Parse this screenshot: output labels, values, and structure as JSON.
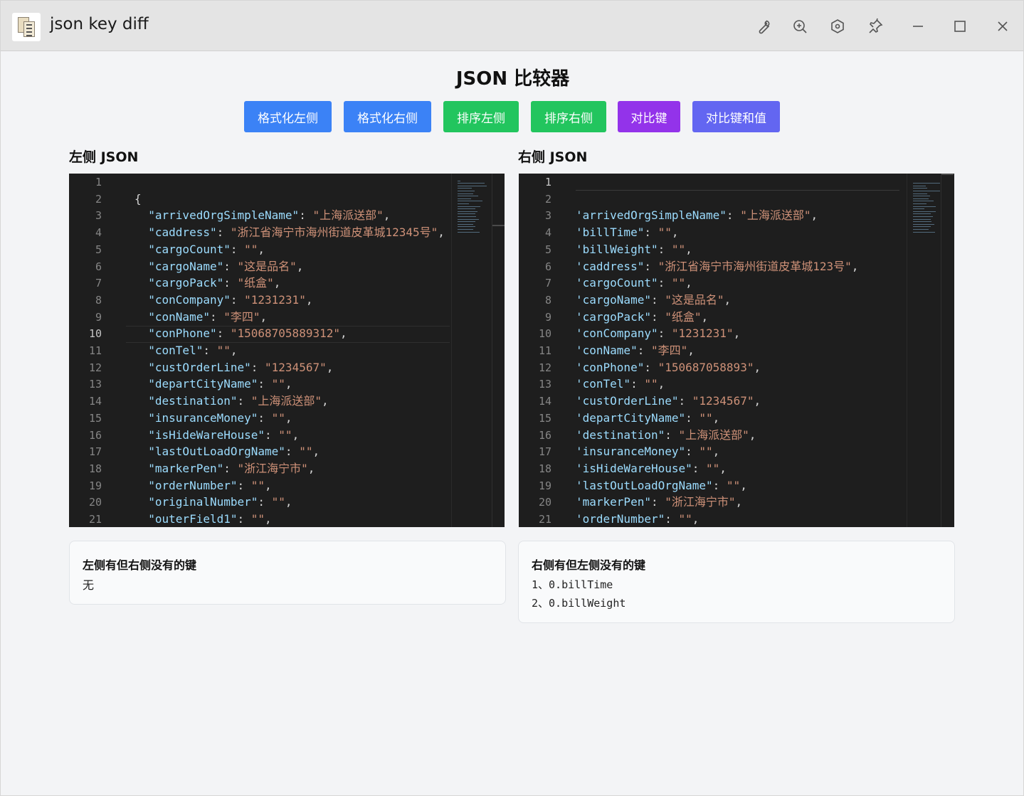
{
  "window": {
    "title": "json key diff",
    "icons": [
      "wrench-icon",
      "zoom-in-icon",
      "hexagon-settings-icon",
      "pin-icon",
      "minimize-icon",
      "maximize-icon",
      "close-icon"
    ]
  },
  "page": {
    "title": "JSON 比较器",
    "buttons": {
      "format_left": "格式化左侧",
      "format_right": "格式化右侧",
      "sort_left": "排序左侧",
      "sort_right": "排序右侧",
      "compare_keys": "对比键",
      "compare_keys_values": "对比键和值"
    },
    "colors": {
      "blue": "#3b82f6",
      "green": "#22c55e",
      "purple": "#9333ea",
      "indigo": "#6366f1",
      "editor_bg": "#1e1e1e",
      "key": "#9cdcfe",
      "string": "#ce9178"
    }
  },
  "left": {
    "label": "左侧 JSON",
    "active_line": 10,
    "lines": [
      {
        "n": "1",
        "indent": "",
        "key": "",
        "val": "",
        "raw": ""
      },
      {
        "n": "2",
        "indent": "",
        "key": "",
        "val": "",
        "raw": "{"
      },
      {
        "n": "3",
        "indent": "  ",
        "key": "\"arrivedOrgSimpleName\"",
        "val": "\"上海派送部\"",
        "raw": ""
      },
      {
        "n": "4",
        "indent": "  ",
        "key": "\"caddress\"",
        "val": "\"浙江省海宁市海州街道皮革城12345号\"",
        "raw": ""
      },
      {
        "n": "5",
        "indent": "  ",
        "key": "\"cargoCount\"",
        "val": "\"\"",
        "raw": ""
      },
      {
        "n": "6",
        "indent": "  ",
        "key": "\"cargoName\"",
        "val": "\"这是品名\"",
        "raw": ""
      },
      {
        "n": "7",
        "indent": "  ",
        "key": "\"cargoPack\"",
        "val": "\"纸盒\"",
        "raw": ""
      },
      {
        "n": "8",
        "indent": "  ",
        "key": "\"conCompany\"",
        "val": "\"1231231\"",
        "raw": ""
      },
      {
        "n": "9",
        "indent": "  ",
        "key": "\"conName\"",
        "val": "\"李四\"",
        "raw": ""
      },
      {
        "n": "10",
        "indent": "  ",
        "key": "\"conPhone\"",
        "val": "\"15068705889312\"",
        "raw": ""
      },
      {
        "n": "11",
        "indent": "  ",
        "key": "\"conTel\"",
        "val": "\"\"",
        "raw": ""
      },
      {
        "n": "12",
        "indent": "  ",
        "key": "\"custOrderLine\"",
        "val": "\"1234567\"",
        "raw": ""
      },
      {
        "n": "13",
        "indent": "  ",
        "key": "\"departCityName\"",
        "val": "\"\"",
        "raw": ""
      },
      {
        "n": "14",
        "indent": "  ",
        "key": "\"destination\"",
        "val": "\"上海派送部\"",
        "raw": ""
      },
      {
        "n": "15",
        "indent": "  ",
        "key": "\"insuranceMoney\"",
        "val": "\"\"",
        "raw": ""
      },
      {
        "n": "16",
        "indent": "  ",
        "key": "\"isHideWareHouse\"",
        "val": "\"\"",
        "raw": ""
      },
      {
        "n": "17",
        "indent": "  ",
        "key": "\"lastOutLoadOrgName\"",
        "val": "\"\"",
        "raw": ""
      },
      {
        "n": "18",
        "indent": "  ",
        "key": "\"markerPen\"",
        "val": "\"浙江海宁市\"",
        "raw": ""
      },
      {
        "n": "19",
        "indent": "  ",
        "key": "\"orderNumber\"",
        "val": "\"\"",
        "raw": ""
      },
      {
        "n": "20",
        "indent": "  ",
        "key": "\"originalNumber\"",
        "val": "\"\"",
        "raw": ""
      },
      {
        "n": "21",
        "indent": "  ",
        "key": "\"outerField1\"",
        "val": "\"\"",
        "raw": ""
      }
    ]
  },
  "right": {
    "label": "右侧 JSON",
    "active_line": 1,
    "lines": [
      {
        "n": "1",
        "key": "",
        "val": ""
      },
      {
        "n": "2",
        "key": "",
        "val": ""
      },
      {
        "n": "3",
        "key": "'arrivedOrgSimpleName\"",
        "val": "\"上海派送部\""
      },
      {
        "n": "4",
        "key": "'billTime\"",
        "val": "\"\""
      },
      {
        "n": "5",
        "key": "'billWeight\"",
        "val": "\"\""
      },
      {
        "n": "6",
        "key": "'caddress\"",
        "val": "\"浙江省海宁市海州街道皮革城123号\""
      },
      {
        "n": "7",
        "key": "'cargoCount\"",
        "val": "\"\""
      },
      {
        "n": "8",
        "key": "'cargoName\"",
        "val": "\"这是品名\""
      },
      {
        "n": "9",
        "key": "'cargoPack\"",
        "val": "\"纸盒\""
      },
      {
        "n": "10",
        "key": "'conCompany\"",
        "val": "\"1231231\""
      },
      {
        "n": "11",
        "key": "'conName\"",
        "val": "\"李四\""
      },
      {
        "n": "12",
        "key": "'conPhone\"",
        "val": "\"150687058893\""
      },
      {
        "n": "13",
        "key": "'conTel\"",
        "val": "\"\""
      },
      {
        "n": "14",
        "key": "'custOrderLine\"",
        "val": "\"1234567\""
      },
      {
        "n": "15",
        "key": "'departCityName\"",
        "val": "\"\""
      },
      {
        "n": "16",
        "key": "'destination\"",
        "val": "\"上海派送部\""
      },
      {
        "n": "17",
        "key": "'insuranceMoney\"",
        "val": "\"\""
      },
      {
        "n": "18",
        "key": "'isHideWareHouse\"",
        "val": "\"\""
      },
      {
        "n": "19",
        "key": "'lastOutLoadOrgName\"",
        "val": "\"\""
      },
      {
        "n": "20",
        "key": "'markerPen\"",
        "val": "\"浙江海宁市\""
      },
      {
        "n": "21",
        "key": "'orderNumber\"",
        "val": "\"\""
      }
    ]
  },
  "results": {
    "left_only_title": "左侧有但右侧没有的键",
    "left_only_empty": "无",
    "right_only_title": "右侧有但左侧没有的键",
    "right_only_items": [
      "1、0.billTime",
      "2、0.billWeight"
    ]
  }
}
